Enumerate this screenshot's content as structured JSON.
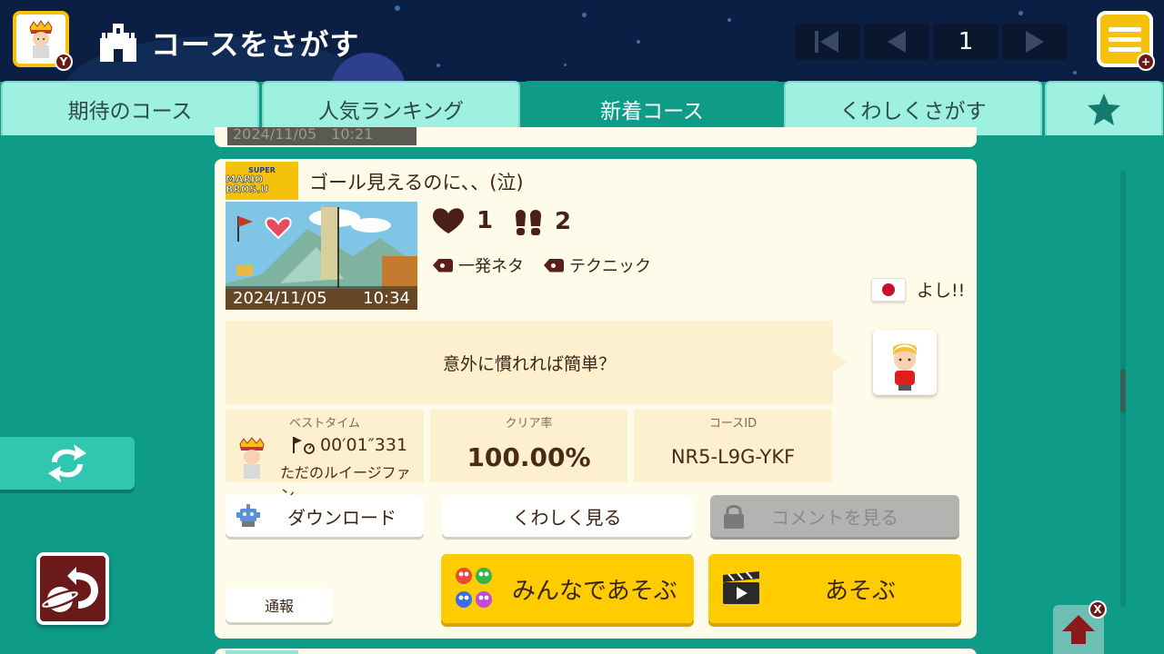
{
  "header": {
    "title": "コースをさがす",
    "avatar_badge": "Y",
    "menu_badge": "+",
    "page_number": "1"
  },
  "tabs": [
    {
      "label": "期待のコース",
      "active": false
    },
    {
      "label": "人気ランキング",
      "active": false
    },
    {
      "label": "新着コース",
      "active": true
    },
    {
      "label": "くわしくさがす",
      "active": false
    }
  ],
  "previous_card": {
    "date": "2024/11/05　10:21"
  },
  "course": {
    "game_style_line1": "SUPER",
    "game_style_line2": "MARIO BROS.U",
    "title": "ゴール見えるのに、、(泣)",
    "date": "2024/11/05",
    "time": "10:34",
    "likes": "1",
    "plays": "2",
    "tags": [
      "一発ネタ",
      "テクニック"
    ],
    "creator_name": "よし!!",
    "creator_country_flag": "Japan",
    "description": "意外に慣れれば簡単？",
    "best_time_label": "ベストタイム",
    "best_time": "00′01″331",
    "best_time_holder": "ただのルイージファン",
    "clear_rate_label": "クリア率",
    "clear_rate": "100.00%",
    "course_id_label": "コースID",
    "course_id": "NR5-L9G-YKF"
  },
  "buttons": {
    "download": "ダウンロード",
    "details": "くわしく見る",
    "comments": "コメントを見る",
    "report": "通報",
    "multiplayer": "みんなであそぶ",
    "play": "あそぶ"
  },
  "side": {
    "top_button_badge": "X"
  },
  "colors": {
    "background": "#0e9b87",
    "header": "#0b1f44",
    "tab_inactive": "#9ef0e0",
    "card": "#fffbea",
    "accent_yellow": "#ffcc00",
    "brown": "#6b1a1a"
  },
  "icons": [
    "castle-icon",
    "heart-icon",
    "footprints-icon",
    "tag-icon",
    "refresh-icon",
    "back-planet-icon",
    "arrow-up-icon",
    "star-icon",
    "lock-icon",
    "clapperboard-icon",
    "flag-timer-icon"
  ]
}
